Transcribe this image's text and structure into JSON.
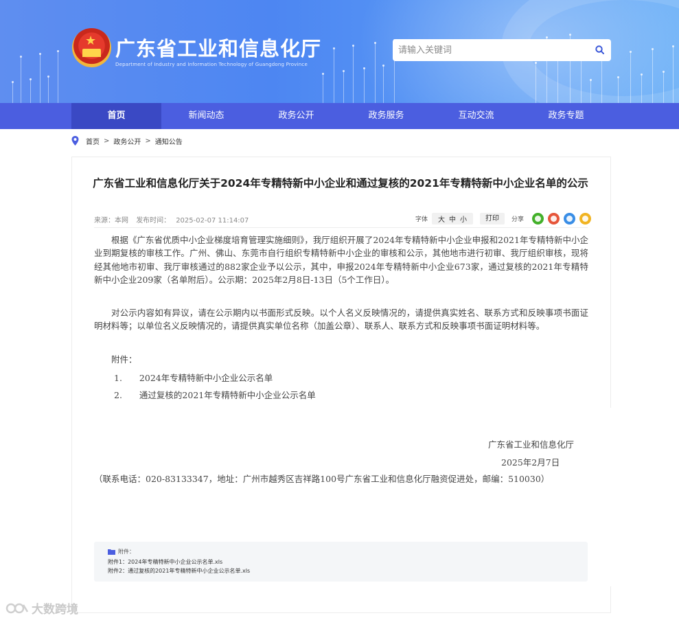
{
  "header": {
    "site_title": "广东省工业和信息化厅",
    "site_subtitle": "Department of Industry and Information Technology of Guangdong Province",
    "search_placeholder": "请输入关键词"
  },
  "nav": {
    "items": [
      {
        "label": "首页",
        "active": true
      },
      {
        "label": "新闻动态"
      },
      {
        "label": "政务公开"
      },
      {
        "label": "政务服务"
      },
      {
        "label": "互动交流"
      },
      {
        "label": "政务专题"
      }
    ]
  },
  "breadcrumb": [
    "首页",
    "政务公开",
    "通知公告"
  ],
  "article": {
    "title": "广东省工业和信息化厅关于2024年专精特新中小企业和通过复核的2021年专精特新中小企业名单的公示",
    "source": "来源：本网",
    "publish_label": "发布时间：",
    "publish_time": "2025-02-07 11:14:07",
    "font_label": "字体",
    "font_sizes": [
      "大",
      "中",
      "小"
    ],
    "print_label": "打印",
    "share_label": "分享",
    "paragraph1": "根据《广东省优质中小企业梯度培育管理实施细则》，我厅组织开展了2024年专精特新中小企业申报和2021年专精特新中小企业到期复核的审核工作。广州、佛山、东莞市自行组织专精特新中小企业的审核和公示，其他地市进行初审、我厅组织审核，现将经其他地市初审、我厅审核通过的882家企业予以公示，其中，申报2024年专精特新中小企业673家，通过复核的2021年专精特新中小企业209家（名单附后）。公示期：2025年2月8日-13日（5个工作日）。",
    "paragraph2": "对公示内容如有异议，请在公示期内以书面形式反映。以个人名义反映情况的，请提供真实姓名、联系方式和反映事项书面证明材料等；以单位名义反映情况的，请提供真实单位名称（加盖公章）、联系人、联系方式和反映事项书面证明材料等。",
    "attach_label": "附件：",
    "attach_items": [
      "1.　　2024年专精特新中小企业公示名单",
      "2.　　通过复核的2021年专精特新中小企业公示名单"
    ],
    "signature": "广东省工业和信息化厅",
    "date": "2025年2月7日",
    "contact": "（联系电话：020-83133347，地址：广州市越秀区吉祥路100号广东省工业和信息化厅融资促进处，邮编：510030）"
  },
  "attachments": {
    "header": "附件：",
    "files": [
      "附件1：2024年专精特新中小企业公示名单.xls",
      "附件2：通过复核的2021年专精特新中小企业公示名单.xls"
    ]
  },
  "watermark": "大数跨境",
  "colors": {
    "nav_bg": "#4b5ee0",
    "nav_active": "#3a49c4",
    "banner_blue": "#4d86f2",
    "share_wechat": "#43b02a",
    "share_weibo": "#e6563b",
    "share_qq": "#3a8ee6",
    "share_qzone": "#f1b422"
  }
}
